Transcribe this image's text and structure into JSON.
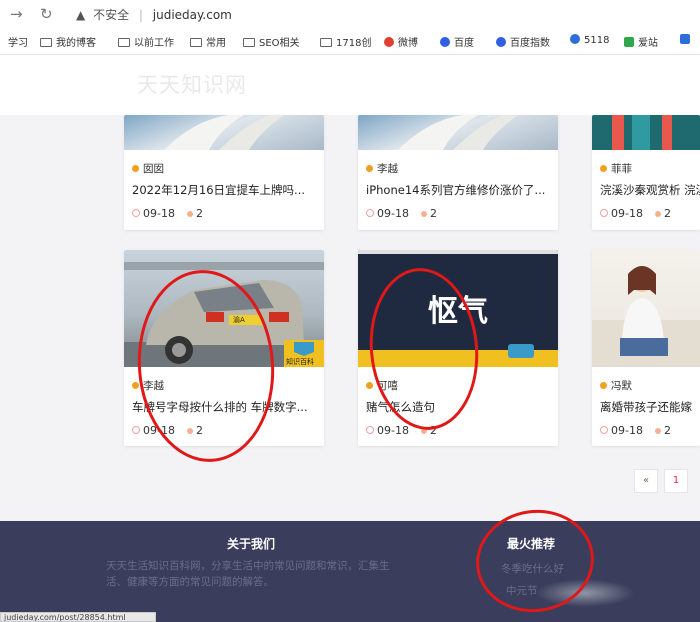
{
  "browser": {
    "insecure_label": "不安全",
    "url": "judieday.com",
    "bookmarks": [
      "学习",
      "我的博客",
      "以前工作",
      "常用",
      "SEO相关",
      "1718创",
      "微博",
      "百度",
      "百度指数",
      "5118",
      "爱站"
    ]
  },
  "site": {
    "logo": "天天知识网"
  },
  "cards": [
    {
      "author": "囡囡",
      "title": "2022年12月16日宜提车上牌吗...",
      "date": "09-18",
      "comments": "2"
    },
    {
      "author": "李越",
      "title": "iPhone14系列官方维修价涨价了...",
      "date": "09-18",
      "comments": "2"
    },
    {
      "author": "菲菲",
      "title": "浣溪沙秦观赏析 浣溪",
      "date": "09-18",
      "comments": "2"
    },
    {
      "author": "李越",
      "title": "车牌号字母按什么排的 车牌数字...",
      "date": "09-18",
      "comments": "2",
      "thumb_text": "知识百科",
      "plate": "渝A"
    },
    {
      "author": "可嘻",
      "title": "赌气怎么造句",
      "date": "09-18",
      "comments": "2",
      "thumb_text": "怄气"
    },
    {
      "author": "冯默",
      "title": "离婚带孩子还能嫁",
      "date": "09-18",
      "comments": "2"
    }
  ],
  "pagination": {
    "prev": "«",
    "page": "1"
  },
  "footer": {
    "about_title": "关于我们",
    "about_text": "天天生活知识百科网，分享生活中的常见问题和常识，汇集生活、健康等方面的常见问题的解答。",
    "hot_title": "最火推荐",
    "hot_items": [
      "冬季吃什么好",
      "中元节"
    ]
  },
  "statusbar": "judieday.com/post/28854.html",
  "colors": {
    "footer_bg": "#3a3d5c",
    "annotation": "#e01818",
    "accent": "#f0a020"
  }
}
